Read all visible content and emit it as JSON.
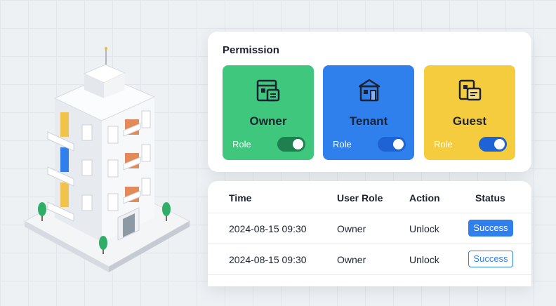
{
  "colors": {
    "owner_tile": "#3ec77d",
    "tenant_tile": "#2f80ed",
    "guest_tile": "#f5cc3d",
    "toggle_owner": "#1f7f4e",
    "toggle_blue": "#1e63d6",
    "success": "#2f80ed"
  },
  "permission": {
    "title": "Permission",
    "roles": [
      {
        "name": "Owner",
        "toggle_label": "Role",
        "enabled": true,
        "icon": "owner-building-icon"
      },
      {
        "name": "Tenant",
        "toggle_label": "Role",
        "enabled": true,
        "icon": "tenant-house-icon"
      },
      {
        "name": "Guest",
        "toggle_label": "Role",
        "enabled": true,
        "icon": "guest-card-icon"
      }
    ]
  },
  "log": {
    "headers": {
      "time": "Time",
      "user_role": "User Role",
      "action": "Action",
      "status": "Status"
    },
    "rows": [
      {
        "time": "2024-08-15 09:30",
        "user_role": "Owner",
        "action": "Unlock",
        "status": "Success"
      },
      {
        "time": "2024-08-15 09:30",
        "user_role": "Owner",
        "action": "Unlock",
        "status": "Success"
      }
    ]
  }
}
